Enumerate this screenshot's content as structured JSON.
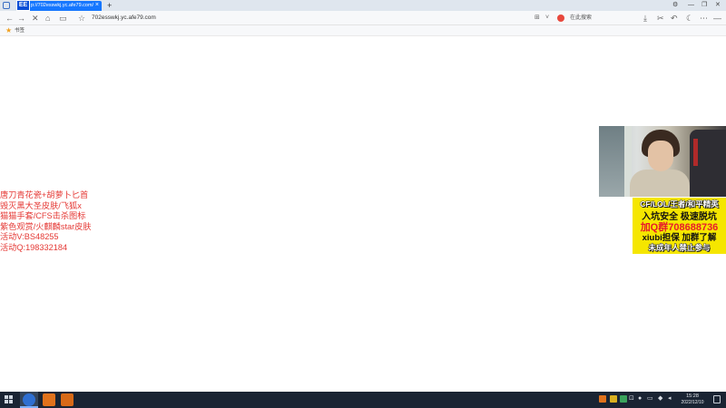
{
  "browser": {
    "tab": {
      "logo_text": "EE",
      "title": "p://702esswkj.yc.afe79.com/",
      "close_glyph": "×"
    },
    "new_tab_glyph": "+",
    "address_bar": {
      "url": "702esswkj.yc.afe79.com"
    },
    "search_engine": {
      "label": "在此搜索"
    },
    "bookmarks_bar": {
      "label": "书签"
    },
    "icons": {
      "back": "←",
      "forward": "→",
      "stop": "✕",
      "home": "⌂",
      "reader": "▭",
      "bookmark": "☆",
      "download": "⤓",
      "scissors": "✂",
      "undo": "↶",
      "moon": "☾",
      "more": "⋯",
      "grid": "⊞",
      "settings": "⚙",
      "minimize": "—",
      "maximize": "❐",
      "close": "✕",
      "chevron": "˅"
    }
  },
  "overlay_text": {
    "lines": [
      "唐刀青花瓷+胡萝卜匕首",
      "毁灭黑大圣皮肤/飞狐x",
      "猫猫手套/CFS击杀图标",
      "紫色观赏/火麒麟star皮肤",
      "活动V:BS48255",
      "活动Q:198332184"
    ]
  },
  "ad_panel": {
    "line1": "CF/LOL/王者/和平精英",
    "line2": "入坑安全 极速脱坑",
    "line3": "加Q群708688736",
    "line4": "xiubi担保 加群了解",
    "line5": "未成年人禁止参与"
  },
  "taskbar": {
    "clock": {
      "time": "15:28",
      "date": "2022/12/10"
    }
  },
  "colors": {
    "overlay_text": "#e53935",
    "ad_background": "#f5e600",
    "ad_highlight": "#e8192c",
    "tab_active": "#1677ff",
    "taskbar": "#1a2433"
  }
}
